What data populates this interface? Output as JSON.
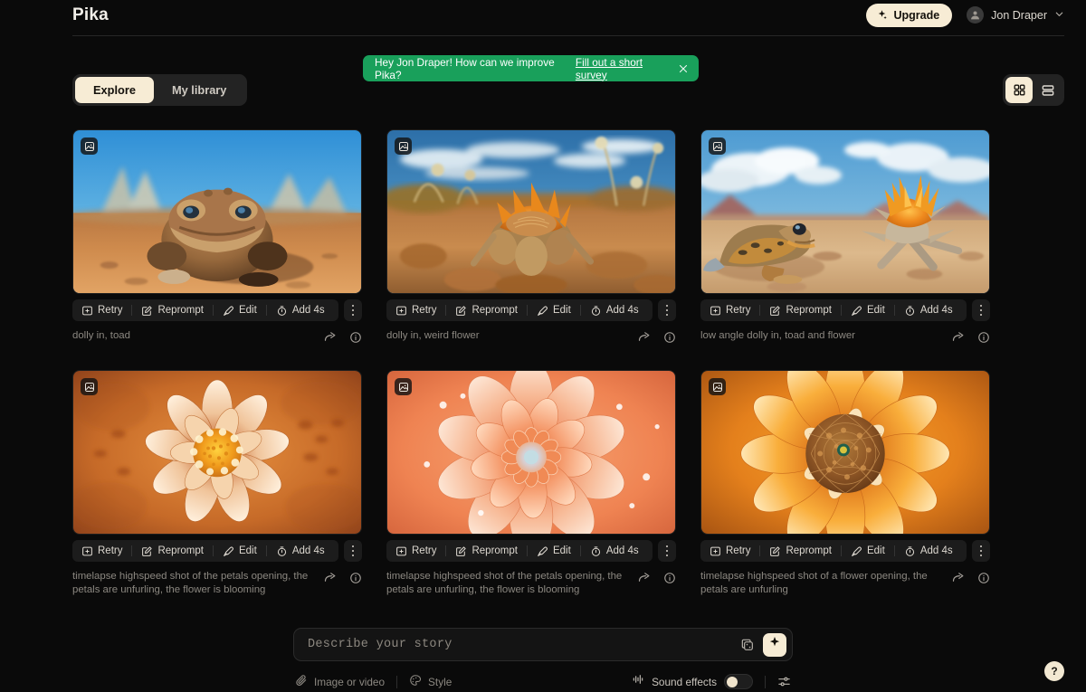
{
  "app": {
    "logo": "Pika",
    "accent_cream": "#f7ecd5",
    "accent_green": "#19a05b",
    "bg": "#0a0a0a"
  },
  "header": {
    "upgrade_label": "Upgrade",
    "user_name": "Jon Draper",
    "upgrade_icon": "sparkle-icon",
    "avatar_icon": "user-avatar-icon",
    "chevron_icon": "chevron-down-icon"
  },
  "toast": {
    "message": "Hey Jon Draper! How can we improve Pika?",
    "link_label": "Fill out a short survey",
    "close_icon": "close-icon"
  },
  "tabs": {
    "items": [
      {
        "label": "Explore",
        "active": true
      },
      {
        "label": "My library",
        "active": false
      }
    ]
  },
  "view_toggle": {
    "grid_icon": "grid-view-icon",
    "list_icon": "list-view-icon",
    "active": "grid"
  },
  "card_actions": {
    "retry": "Retry",
    "reprompt": "Reprompt",
    "edit": "Edit",
    "add": "Add 4s",
    "retry_icon": "retry-box-plus-icon",
    "reprompt_icon": "pencil-square-icon",
    "edit_icon": "brush-icon",
    "add_icon": "clock-add-icon",
    "menu_icon": "more-vertical-icon",
    "share_icon": "share-arrow-icon",
    "info_icon": "info-circle-icon",
    "media_badge_icon": "image-badge-icon"
  },
  "cards": [
    {
      "id": "c1",
      "caption": "dolly in, toad",
      "art": "toad-desert"
    },
    {
      "id": "c2",
      "caption": "dolly in, weird flower",
      "art": "weird-flower-desert"
    },
    {
      "id": "c3",
      "caption": "low angle dolly in, toad and flower",
      "art": "toad-and-flower"
    },
    {
      "id": "c4",
      "caption": "timelapse highspeed shot of the petals opening, the petals are unfurling, the flower is blooming",
      "art": "dahlia-peach"
    },
    {
      "id": "c5",
      "caption": "timelapse highspeed shot of the petals opening, the petals are unfurling, the flower is blooming",
      "art": "dahlia-coral"
    },
    {
      "id": "c6",
      "caption": "timelapse highspeed shot of a flower opening, the petals are unfurling",
      "art": "dahlia-orange"
    }
  ],
  "prompt_dock": {
    "placeholder": "Describe your story",
    "value": "",
    "dice_icon": "shuffle-dice-icon",
    "generate_icon": "sparkle-icon",
    "attach_label": "Image or video",
    "attach_icon": "paperclip-icon",
    "style_label": "Style",
    "style_icon": "palette-icon",
    "sound_label": "Sound effects",
    "sound_icon": "sound-effects-icon",
    "sound_on": false,
    "settings_icon": "sliders-icon"
  },
  "help": {
    "label": "?",
    "icon": "help-circle-icon"
  }
}
